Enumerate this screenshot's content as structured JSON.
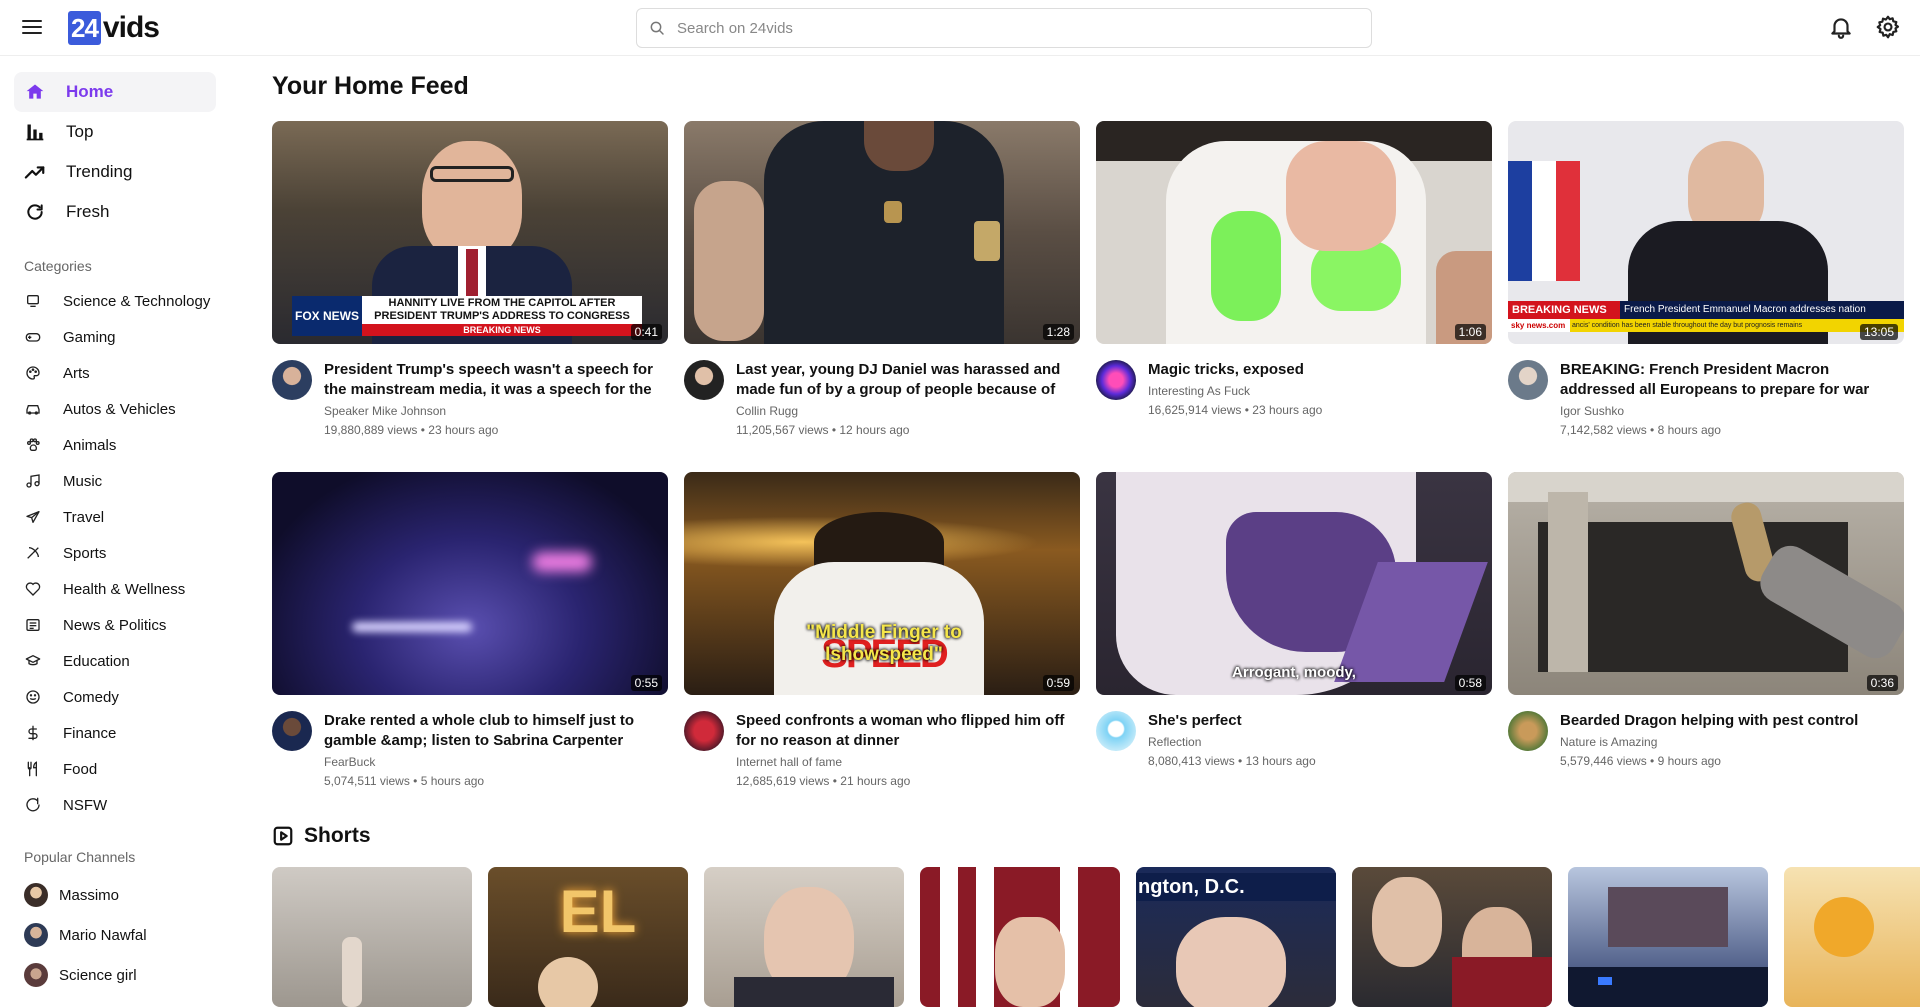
{
  "header": {
    "logo_number": "24",
    "logo_text": "vids",
    "search_placeholder": "Search on 24vids"
  },
  "sidebar": {
    "nav": [
      {
        "label": "Home",
        "icon": "home-icon",
        "active": true
      },
      {
        "label": "Top",
        "icon": "bar-chart-icon"
      },
      {
        "label": "Trending",
        "icon": "trending-icon"
      },
      {
        "label": "Fresh",
        "icon": "refresh-icon"
      }
    ],
    "categories_title": "Categories",
    "categories": [
      {
        "label": "Science & Technology",
        "icon": "science-icon"
      },
      {
        "label": "Gaming",
        "icon": "gamepad-icon"
      },
      {
        "label": "Arts",
        "icon": "palette-icon"
      },
      {
        "label": "Autos & Vehicles",
        "icon": "car-icon"
      },
      {
        "label": "Animals",
        "icon": "paw-icon"
      },
      {
        "label": "Music",
        "icon": "music-icon"
      },
      {
        "label": "Travel",
        "icon": "plane-icon"
      },
      {
        "label": "Sports",
        "icon": "sports-icon"
      },
      {
        "label": "Health & Wellness",
        "icon": "heart-icon"
      },
      {
        "label": "News & Politics",
        "icon": "newspaper-icon"
      },
      {
        "label": "Education",
        "icon": "graduation-cap-icon"
      },
      {
        "label": "Comedy",
        "icon": "smile-icon"
      },
      {
        "label": "Finance",
        "icon": "dollar-icon"
      },
      {
        "label": "Food",
        "icon": "utensils-icon"
      },
      {
        "label": "NSFW",
        "icon": "nsfw-icon"
      }
    ],
    "channels_title": "Popular Channels",
    "channels": [
      {
        "label": "Massimo"
      },
      {
        "label": "Mario Nawfal"
      },
      {
        "label": "Science girl"
      }
    ]
  },
  "main": {
    "title": "Your Home Feed",
    "videos": [
      {
        "title": "President Trump's speech wasn't a speech for the mainstream media, it was a speech for the American people",
        "channel": "Speaker Mike Johnson",
        "stats": "19,880,889 views • 23 hours ago",
        "duration": "0:41",
        "overlay_top": "HANNITY LIVE FROM THE CAPITOL AFTER",
        "overlay_bottom": "PRESIDENT TRUMP'S ADDRESS TO CONGRESS",
        "overlay_tag": "BREAKING NEWS",
        "overlay_logo": "FOX NEWS"
      },
      {
        "title": "Last year, young DJ Daniel was harassed and made fun of by a group of people because of his dream",
        "channel": "Collin Rugg",
        "stats": "11,205,567 views • 12 hours ago",
        "duration": "1:28"
      },
      {
        "title": "Magic tricks, exposed",
        "channel": "Interesting As Fuck",
        "stats": "16,625,914 views • 23 hours ago",
        "duration": "1:06"
      },
      {
        "title": " BREAKING: French President Macron addressed all Europeans to prepare for war with Russia. This is huge",
        "channel": "Igor Sushko",
        "stats": "7,142,582 views • 8 hours ago",
        "duration": "13:05",
        "overlay_tag": "BREAKING NEWS",
        "overlay_headline": "French President Emmanuel Macron addresses nation",
        "overlay_logo": "sky news.com",
        "overlay_ticker": "ancis' condition has been stable throughout the day but prognosis remains "
      },
      {
        "title": "Drake rented a whole club to himself just to gamble &amp; listen to Sabrina Carpenter ",
        "channel": "FearBuck",
        "stats": "5,074,511 views • 5 hours ago",
        "duration": "0:55"
      },
      {
        "title": "Speed confronts a woman who flipped him off for no reason at dinner ",
        "channel": "Internet hall of fame",
        "stats": "12,685,619 views • 21 hours ago",
        "duration": "0:59",
        "overlay_caption": "\"Middle Finger to Ishowspeed\"",
        "overlay_jersey": "SPEED"
      },
      {
        "title": "She's perfect",
        "channel": "Reflection",
        "stats": "8,080,413 views • 13 hours ago",
        "duration": "0:58",
        "overlay_caption": "Arrogant, moody,"
      },
      {
        "title": "Bearded Dragon helping with pest control",
        "channel": "Nature is Amazing ",
        "stats": "5,579,446 views • 9 hours ago",
        "duration": "0:36"
      }
    ],
    "shorts_title": "Shorts",
    "shorts": [
      {
        "overlay": ""
      },
      {
        "overlay": "EL"
      },
      {
        "overlay": ""
      },
      {
        "overlay": ""
      },
      {
        "overlay": "ngton, D.C."
      },
      {
        "overlay": ""
      },
      {
        "overlay": ""
      },
      {
        "overlay": ""
      }
    ]
  },
  "colors": {
    "accent": "#7c3aed",
    "logo_blue": "#3b5bdb",
    "breaking_red": "#d3131d"
  }
}
